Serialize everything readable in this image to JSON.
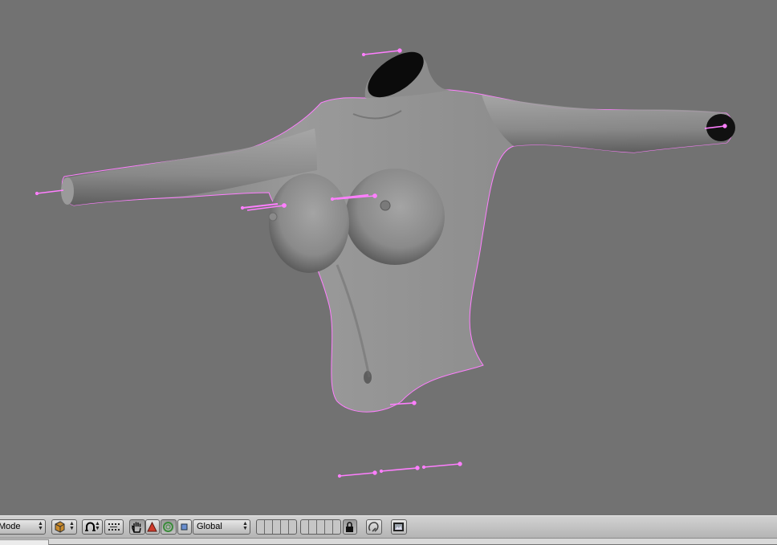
{
  "header": {
    "mode_label": "Mode",
    "orientation_label": "Global"
  },
  "icons": {
    "object_type": "cube-shaded-icon",
    "pivot": "pivot-icon",
    "snap": "snap-dots-icon",
    "manipulator_hand": "hand-icon",
    "translate": "triangle-icon",
    "rotate": "ring-icon",
    "scale": "square-icon",
    "lock": "lock-icon",
    "proportional_edit": "magnet-icon",
    "render": "render-image-icon"
  },
  "colors": {
    "viewport_bg": "#727272",
    "bone_outline": "#ff7fff",
    "header_bg": "#c4c4c4"
  }
}
